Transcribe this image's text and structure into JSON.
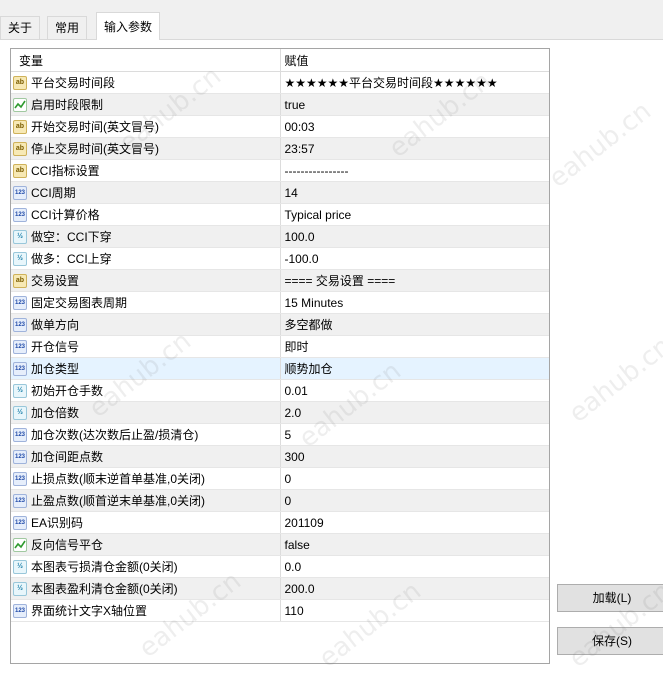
{
  "tabs": [
    {
      "label": "关于"
    },
    {
      "label": "常用"
    },
    {
      "label": "输入参数"
    }
  ],
  "table": {
    "headers": [
      "变量",
      "赋值"
    ],
    "rows": [
      {
        "icon": "ab",
        "name": "平台交易时间段",
        "value": "★★★★★★平台交易时间段★★★★★★"
      },
      {
        "icon": "bool",
        "name": "启用时段限制",
        "value": "true"
      },
      {
        "icon": "ab",
        "name": "开始交易时间(英文冒号)",
        "value": "00:03"
      },
      {
        "icon": "ab",
        "name": "停止交易时间(英文冒号)",
        "value": "23:57"
      },
      {
        "icon": "ab",
        "name": "CCI指标设置",
        "value": "----------------"
      },
      {
        "icon": "int",
        "name": "CCI周期",
        "value": "14"
      },
      {
        "icon": "int",
        "name": "CCI计算价格",
        "value": "Typical price"
      },
      {
        "icon": "dbl",
        "name": "做空：CCI下穿",
        "value": "100.0"
      },
      {
        "icon": "dbl",
        "name": "做多：CCI上穿",
        "value": "-100.0"
      },
      {
        "icon": "ab",
        "name": "交易设置",
        "value": "==== 交易设置 ===="
      },
      {
        "icon": "int",
        "name": "固定交易图表周期",
        "value": "15 Minutes"
      },
      {
        "icon": "int",
        "name": "做单方向",
        "value": "多空都做"
      },
      {
        "icon": "int",
        "name": "开仓信号",
        "value": "即时"
      },
      {
        "icon": "int",
        "name": "加仓类型",
        "value": "顺势加仓"
      },
      {
        "icon": "dbl",
        "name": "初始开仓手数",
        "value": "0.01"
      },
      {
        "icon": "dbl",
        "name": "加仓倍数",
        "value": "2.0"
      },
      {
        "icon": "int",
        "name": "加仓次数(达次数后止盈/损清仓)",
        "value": "5"
      },
      {
        "icon": "int",
        "name": "加仓间距点数",
        "value": "300"
      },
      {
        "icon": "int",
        "name": "止损点数(顺末逆首单基准,0关闭)",
        "value": "0"
      },
      {
        "icon": "int",
        "name": "止盈点数(顺首逆末单基准,0关闭)",
        "value": "0"
      },
      {
        "icon": "int",
        "name": "EA识别码",
        "value": "201109"
      },
      {
        "icon": "bool",
        "name": "反向信号平仓",
        "value": "false"
      },
      {
        "icon": "dbl",
        "name": "本图表亏损清仓金额(0关闭)",
        "value": "0.0"
      },
      {
        "icon": "dbl",
        "name": "本图表盈利清仓金额(0关闭)",
        "value": "200.0"
      },
      {
        "icon": "int",
        "name": "界面统计文字X轴位置",
        "value": "110"
      }
    ],
    "selected_index": 13
  },
  "buttons": {
    "load": "加载(L)",
    "save": "保存(S)"
  },
  "watermark": "eahub.cn",
  "icon_text": {
    "ab": "ab",
    "int": "123",
    "dbl": "½"
  }
}
